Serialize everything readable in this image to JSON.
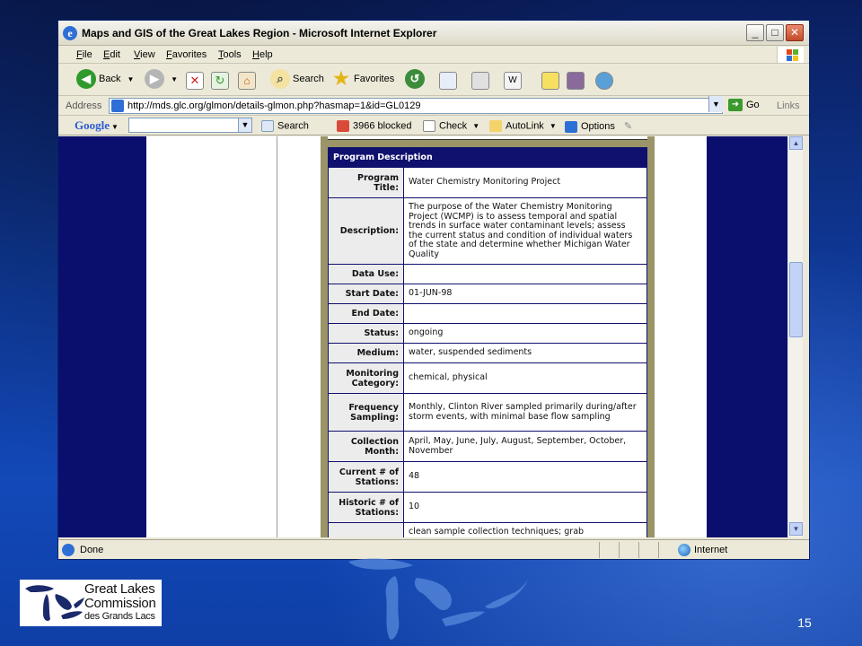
{
  "window": {
    "title": "Maps and GIS of the Great Lakes Region - Microsoft Internet Explorer",
    "minimize": "_",
    "maximize": "□",
    "close": "✕"
  },
  "menu": [
    "File",
    "Edit",
    "View",
    "Favorites",
    "Tools",
    "Help"
  ],
  "toolbar": {
    "back": "Back",
    "search": "Search",
    "favorites": "Favorites"
  },
  "address": {
    "label": "Address",
    "url": "http://mds.glc.org/glmon/details-glmon.php?hasmap=1&id=GL0129",
    "go": "Go",
    "links": "Links"
  },
  "google_bar": {
    "logo": "Google",
    "search": "Search",
    "blocked": "3966 blocked",
    "check": "Check",
    "autolink": "AutoLink",
    "options": "Options"
  },
  "program": {
    "header": "Program Description",
    "rows": [
      {
        "label": "Program Title:",
        "value": "Water Chemistry Monitoring Project"
      },
      {
        "label": "Description:",
        "value": "The purpose of the Water Chemistry Monitoring Project (WCMP) is to assess temporal and spatial trends in surface water contaminant levels; assess the current status and condition of individual waters of the state and determine whether Michigan Water Quality"
      },
      {
        "label": "Data Use:",
        "value": ""
      },
      {
        "label": "Start Date:",
        "value": "01-JUN-98"
      },
      {
        "label": "End Date:",
        "value": ""
      },
      {
        "label": "Status:",
        "value": "ongoing"
      },
      {
        "label": "Medium:",
        "value": "water, suspended sediments"
      },
      {
        "label": "Monitoring Category:",
        "value": "chemical, physical"
      },
      {
        "label": "Frequency Sampling:",
        "value": "Monthly, Clinton River sampled primarily during/after storm events, with minimal base flow sampling"
      },
      {
        "label": "Collection Month:",
        "value": "April, May, June, July, August, September, October, November"
      },
      {
        "label": "Current # of Stations:",
        "value": "48"
      },
      {
        "label": "Historic # of Stations:",
        "value": "10"
      },
      {
        "label": "",
        "value": "clean sample collection techniques; grab"
      }
    ]
  },
  "status": {
    "done": "Done",
    "zone": "Internet"
  },
  "slide": {
    "logo_line1": "Great Lakes",
    "logo_line2": "Commission",
    "logo_line3": "des Grands Lacs",
    "page_number": "15"
  }
}
